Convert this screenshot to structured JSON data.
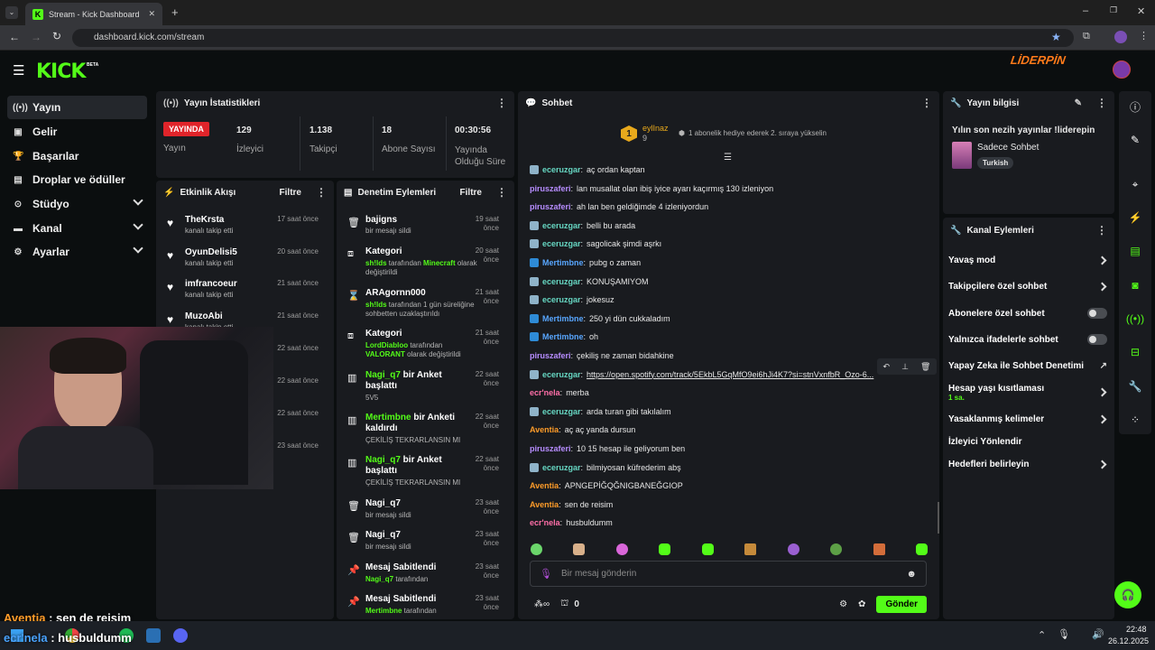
{
  "browser": {
    "tab_title": "Stream - Kick Dashboard",
    "url": "dashboard.kick.com/stream"
  },
  "header": {
    "logo": "KICK",
    "beta": "BETA",
    "partner_logo": "LİDERPİN"
  },
  "nav": {
    "items": [
      {
        "label": "Yayın",
        "icon": "stream-icon"
      },
      {
        "label": "Gelir",
        "icon": "revenue-icon"
      },
      {
        "label": "Başarılar",
        "icon": "trophy-icon"
      },
      {
        "label": "Droplar ve ödüller",
        "icon": "gift-icon"
      },
      {
        "label": "Stüdyo",
        "icon": "studio-icon"
      },
      {
        "label": "Kanal",
        "icon": "channel-icon"
      },
      {
        "label": "Ayarlar",
        "icon": "gear-icon"
      }
    ]
  },
  "stats": {
    "title": "Yayın İstatistikleri",
    "live_badge": "YAYINDA",
    "live_label": "Yayın",
    "viewers": {
      "value": "129",
      "label": "İzleyici"
    },
    "followers": {
      "value": "1.138",
      "label": "Takipçi"
    },
    "subs": {
      "value": "18",
      "label": "Abone Sayısı"
    },
    "duration": {
      "value": "00:30:56",
      "label": "Yayında Olduğu Süre"
    }
  },
  "activity": {
    "title": "Etkinlik Akışı",
    "filter": "Filtre",
    "items": [
      {
        "name": "TheKrsta",
        "sub": "kanalı takip etti",
        "time": "17 saat önce"
      },
      {
        "name": "OyunDelisi5",
        "sub": "kanalı takip etti",
        "time": "20 saat önce"
      },
      {
        "name": "imfrancoeur",
        "sub": "kanalı takip etti",
        "time": "21 saat önce"
      },
      {
        "name": "MuzoAbi",
        "sub": "kanalı takip etti",
        "time": "21 saat önce"
      },
      {
        "name": "",
        "sub": "",
        "time": "22 saat önce"
      },
      {
        "name": "",
        "sub": "",
        "time": "22 saat önce"
      },
      {
        "name": "",
        "sub": "",
        "time": "22 saat önce"
      },
      {
        "name": "",
        "sub": "",
        "time": "23 saat önce"
      }
    ]
  },
  "moderation": {
    "title": "Denetim Eylemleri",
    "filter": "Filtre",
    "items": [
      {
        "name": "bajigns",
        "sub": "bir mesajı sildi",
        "time": "19 saat önce"
      },
      {
        "name": "Kategori",
        "sub_green": "sh!lds",
        "sub": " tarafından ",
        "sub_green2": "Minecraft",
        "sub2": " olarak değiştirildi",
        "time": "20 saat önce"
      },
      {
        "name": "ARAgornn000",
        "sub_green": "sh!lds",
        "sub": " tarafından 1 gün süreliğine sohbetten uzaklaştırıldı",
        "time": "21 saat önce"
      },
      {
        "name": "Kategori",
        "sub_green": "LordDiabloo",
        "sub": " tarafından ",
        "sub_green2": "VALORANT",
        "sub2": " olarak değiştirildi",
        "time": "21 saat önce"
      },
      {
        "name_green": "Nagi_q7",
        "name": " bir Anket başlattı",
        "sub": "5V5",
        "time": "22 saat önce"
      },
      {
        "name_green": "Mertimbne",
        "name": " bir Anketi kaldırdı",
        "sub": "ÇEKİLİŞ TEKRARLANSIN MI",
        "time": "22 saat önce"
      },
      {
        "name_green": "Nagi_q7",
        "name": " bir Anket başlattı",
        "sub": "ÇEKİLİŞ TEKRARLANSIN MI",
        "time": "22 saat önce"
      },
      {
        "name": "Nagi_q7",
        "sub": "bir mesajı sildi",
        "time": "23 saat önce"
      },
      {
        "name": "Nagi_q7",
        "sub": "bir mesajı sildi",
        "time": "23 saat önce"
      },
      {
        "name": "Mesaj Sabitlendi",
        "sub_green": "Nagi_q7",
        "sub": " tarafından",
        "time": "23 saat önce"
      },
      {
        "name": "Mesaj Sabitlendi",
        "sub_green": "Mertimbne",
        "sub": " tarafından",
        "time": "23 saat önce"
      }
    ]
  },
  "chat": {
    "title": "Sohbet",
    "top_gifter": {
      "rank": "1",
      "name": "eylInaz",
      "count": "9"
    },
    "goal_text": "1 abonelik hediye ederek 2. sıraya yükselin",
    "messages": [
      {
        "user": "eceruzgar",
        "text": "aç ordan kaptan",
        "color": "u-teal",
        "badge": "#8fb3c9"
      },
      {
        "user": "piruszaferi",
        "text": "lan musallat olan ibiş iyice ayarı kaçırmış 130 izleniyon",
        "color": "u-purple",
        "badge": ""
      },
      {
        "user": "piruszaferi",
        "text": "ah lan ben geldiğimde 4 izleniyordun",
        "color": "u-purple",
        "badge": ""
      },
      {
        "user": "eceruzgar",
        "text": "belli bu arada",
        "color": "u-teal",
        "badge": "#8fb3c9"
      },
      {
        "user": "eceruzgar",
        "text": "sagolicak şimdi aşrkı",
        "color": "u-teal",
        "badge": "#8fb3c9"
      },
      {
        "user": "Mertimbne",
        "text": "pubg o zaman",
        "color": "u-blue",
        "badge": "#2e8bd6"
      },
      {
        "user": "eceruzgar",
        "text": "KONUŞAMIYOM",
        "color": "u-teal",
        "badge": "#8fb3c9"
      },
      {
        "user": "eceruzgar",
        "text": "jokesuz",
        "color": "u-teal",
        "badge": "#8fb3c9"
      },
      {
        "user": "Mertimbne",
        "text": "250 yi dün cukkaladım",
        "color": "u-blue",
        "badge": "#2e8bd6"
      },
      {
        "user": "Mertimbne",
        "text": "oh",
        "color": "u-blue",
        "badge": "#2e8bd6"
      },
      {
        "user": "piruszaferi",
        "text": "çekiliş ne zaman bidahkine",
        "color": "u-purple",
        "badge": ""
      },
      {
        "user": "eceruzgar",
        "text": "https://open.spotify.com/track/5EkbL5GqMfO9ei6hJi4K7?si=stnVxnfbR_Ozo-6...",
        "color": "u-teal",
        "badge": "#8fb3c9"
      },
      {
        "user": "ecr'nela",
        "text": "merba",
        "color": "u-pink",
        "badge": ""
      },
      {
        "user": "eceruzgar",
        "text": "arda turan gibi takılalım",
        "color": "u-teal",
        "badge": "#8fb3c9"
      },
      {
        "user": "Aventia",
        "text": "aç aç yanda dursun",
        "color": "u-orange",
        "badge": ""
      },
      {
        "user": "piruszaferi",
        "text": "10 15 hesap ile geliyorum ben",
        "color": "u-purple",
        "badge": ""
      },
      {
        "user": "eceruzgar",
        "text": "bilmiyosan küfrederim abş",
        "color": "u-teal",
        "badge": "#8fb3c9"
      },
      {
        "user": "Aventia",
        "text": "APNGEPİĞQĞNIGBANEĞGIOP",
        "color": "u-orange",
        "badge": ""
      },
      {
        "user": "Aventia",
        "text": "sen de reisim",
        "color": "u-orange",
        "badge": ""
      },
      {
        "user": "ecr'nela",
        "text": "husbuldumm",
        "color": "u-pink",
        "badge": ""
      }
    ],
    "input_placeholder": "Bir mesaj gönderin",
    "send_label": "Gönder",
    "points": "0"
  },
  "stream_info": {
    "title": "Yayın bilgisi",
    "stream_title": "Yılın son nezih yayınlar !liderepin",
    "category": "Sadece Sohbet",
    "language": "Turkish"
  },
  "channel_actions": {
    "title": "Kanal Eylemleri",
    "items": [
      {
        "label": "Yavaş mod",
        "type": "arrow"
      },
      {
        "label": "Takipçilere özel sohbet",
        "type": "arrow"
      },
      {
        "label": "Abonelere özel sohbet",
        "type": "toggle"
      },
      {
        "label": "Yalnızca ifadelerle sohbet",
        "type": "toggle"
      },
      {
        "label": "Yapay Zeka ile Sohbet Denetimi",
        "type": "ext"
      },
      {
        "label": "Hesap yaşı kısıtlaması",
        "sub": "1 sa.",
        "type": "arrow"
      },
      {
        "label": "Yasaklanmış kelimeler",
        "type": "arrow"
      },
      {
        "label": "İzleyici Yönlendir",
        "type": "none"
      },
      {
        "label": "Hedefleri belirleyin",
        "type": "arrow"
      }
    ]
  },
  "overlay": {
    "line1_user": "Aventia",
    "line1_text": " : sen de reisim",
    "line2_user": "ecr'nela",
    "line2_text": " : husbuldumm"
  },
  "taskbar": {
    "time": "22:48",
    "date": "26.12.2025"
  },
  "colors": {
    "accent": "#53fc18",
    "live": "#e0242a",
    "panel": "#191b1f",
    "bg": "#0b0e0f"
  }
}
